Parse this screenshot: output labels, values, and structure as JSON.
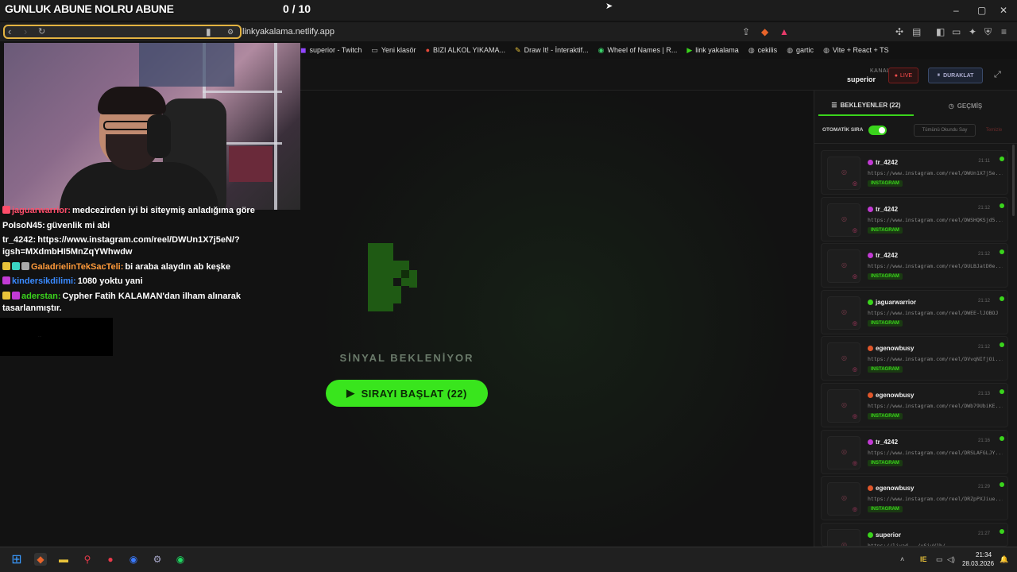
{
  "overlay": {
    "title": "GUNLUK ABUNE NOLRU ABUNE",
    "counter": "0 / 10"
  },
  "window_controls": {
    "minimize": "–",
    "restore": "▢",
    "close": "✕"
  },
  "browser": {
    "url": "linkyakalama.netlify.app",
    "bookmarks": [
      {
        "label": "superior - Twitch",
        "icon": "twitch-icon"
      },
      {
        "label": "Yeni klasör",
        "icon": "folder-icon"
      },
      {
        "label": "BIZI ALKOL YIKAMA...",
        "icon": "site-icon"
      },
      {
        "label": "Draw It! - İnteraktif...",
        "icon": "site-icon"
      },
      {
        "label": "Wheel of Names | R...",
        "icon": "wheel-icon"
      },
      {
        "label": "link yakalama",
        "icon": "play-icon"
      },
      {
        "label": "cekilis",
        "icon": "globe-icon"
      },
      {
        "label": "gartic",
        "icon": "globe-icon"
      },
      {
        "label": "Vite + React + TS",
        "icon": "globe-icon"
      }
    ]
  },
  "app_header": {
    "kanal_label": "KANAL",
    "kanal_name": "superior",
    "live_label": "LIVE",
    "pause_label": "DURAKLAT"
  },
  "main": {
    "signal_text": "SİNYAL BEKLENİYOR",
    "start_label": "SIRAYI BAŞLAT (22)"
  },
  "panel": {
    "tab_waiting": "BEKLEYENLER (22)",
    "tab_history": "GEÇMİŞ",
    "auto_label": "OTOMATİK SIRA",
    "mark_all": "Tümünü Okundu Say",
    "clear": "Temizle",
    "items": [
      {
        "user": "tr_4242",
        "time": "21:11",
        "link": "https://www.instagram.com/reel/DWUn1X7j5e...",
        "platform": "INSTAGRAM",
        "badge_color": "#c23ad4"
      },
      {
        "user": "tr_4242",
        "time": "21:12",
        "link": "https://www.instagram.com/reel/DWSHQKSjd5...",
        "platform": "INSTAGRAM",
        "badge_color": "#c23ad4"
      },
      {
        "user": "tr_4242",
        "time": "21:12",
        "link": "https://www.instagram.com/reel/DULBJatD0e...",
        "platform": "INSTAGRAM",
        "badge_color": "#c23ad4"
      },
      {
        "user": "jaguarwarrior",
        "time": "21:12",
        "link": "https://www.instagram.com/reel/DWEE-lJOBOJ",
        "platform": "INSTAGRAM",
        "badge_color": "#3ad41c"
      },
      {
        "user": "egenowbusy",
        "time": "21:12",
        "link": "https://www.instagram.com/reel/DVvqNIfjOi...",
        "platform": "INSTAGRAM",
        "badge_color": "#e0562a"
      },
      {
        "user": "egenowbusy",
        "time": "21:13",
        "link": "https://www.instagram.com/reel/DWb79UbiKE...",
        "platform": "INSTAGRAM",
        "badge_color": "#e0562a"
      },
      {
        "user": "tr_4242",
        "time": "21:16",
        "link": "https://www.instagram.com/reel/DRSLAFGLJY...",
        "platform": "INSTAGRAM",
        "badge_color": "#c23ad4"
      },
      {
        "user": "egenowbusy",
        "time": "21:29",
        "link": "https://www.instagram.com/reel/DRZpPXJiue...",
        "platform": "INSTAGRAM",
        "badge_color": "#e0562a"
      },
      {
        "user": "superior",
        "time": "21:27",
        "link": "https://livad.../ySjuV1h/",
        "platform": "",
        "badge_color": "#3ad41c"
      }
    ]
  },
  "chat": [
    {
      "name": "jaguarwarrior:",
      "name_color": "#ff4d6a",
      "text": "medcezirden iyi bi siteymiş anladığıma göre"
    },
    {
      "name": "PoIsoN45:",
      "name_color": "#ffffff",
      "text": "güvenlik mi abi"
    },
    {
      "name": "tr_4242:",
      "name_color": "#ffffff",
      "text": "https://www.instagram.com/reel/DWUn1X7j5eN/?igsh=MXdmbHI5MnZqYWhwdw"
    },
    {
      "name": "GaladrielinTekSacTeli:",
      "name_color": "#ff9a3a",
      "text": "bi araba alaydın ab keşke"
    },
    {
      "name": "kindersikdilimi:",
      "name_color": "#3a8aff",
      "text": "1080 yoktu yani"
    },
    {
      "name": "aderstan:",
      "name_color": "#3ad41c",
      "text": "Cypher Fatih KALAMAN'dan ilham alınarak tasarlanmıştır."
    }
  ],
  "chat_box_text": "...",
  "taskbar": {
    "time": "21:34",
    "date": "28.03.2026"
  },
  "colors": {
    "accent": "#3ad41c",
    "live": "#ff4d4d",
    "bg": "#121212"
  }
}
